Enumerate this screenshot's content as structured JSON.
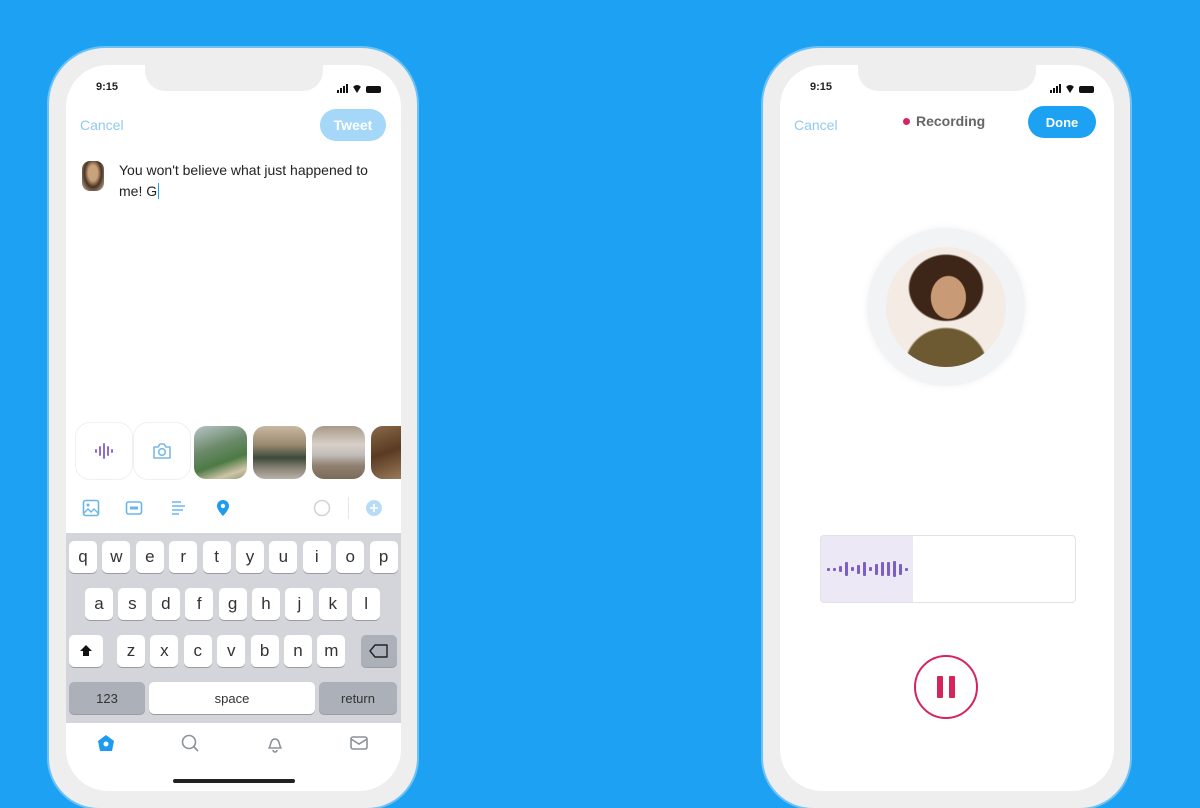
{
  "background_color": "#1da1f2",
  "compose_phone": {
    "status": {
      "time": "9:15"
    },
    "header": {
      "cancel_label": "Cancel",
      "tweet_label": "Tweet"
    },
    "compose": {
      "text": "You won't believe what just happened to me! G"
    },
    "media_row": {
      "voice_icon": "waveform-icon",
      "camera_icon": "camera-icon",
      "thumbnails": [
        "photo-street-trees",
        "photo-car-street",
        "photo-building-water",
        "photo-interior"
      ]
    },
    "toolbar": {
      "icons": [
        "image-icon",
        "gif-icon",
        "poll-icon",
        "location-icon"
      ],
      "right_icons": [
        "character-count-circle",
        "add-thread-icon"
      ]
    },
    "keyboard": {
      "row1": [
        "q",
        "w",
        "e",
        "r",
        "t",
        "y",
        "u",
        "i",
        "o",
        "p"
      ],
      "row2": [
        "a",
        "s",
        "d",
        "f",
        "g",
        "h",
        "j",
        "k",
        "l"
      ],
      "row3": [
        "z",
        "x",
        "c",
        "v",
        "b",
        "n",
        "m"
      ],
      "numbers_label": "123",
      "space_label": "space",
      "return_label": "return"
    },
    "tabbar": {
      "icons": [
        "home-icon",
        "search-icon",
        "notifications-icon",
        "messages-icon"
      ],
      "active": "home-icon"
    }
  },
  "recording_phone": {
    "status": {
      "time": "9:15"
    },
    "header": {
      "cancel_label": "Cancel",
      "status_label": "Recording",
      "done_label": "Done"
    },
    "recording": {
      "accent_color": "#d6245c",
      "waveform_color": "#7b5fc4",
      "waveform_levels": [
        0.15,
        0.15,
        0.35,
        0.8,
        0.2,
        0.5,
        0.8,
        0.2,
        0.6,
        0.8,
        0.8,
        0.9,
        0.6,
        0.15
      ]
    }
  }
}
